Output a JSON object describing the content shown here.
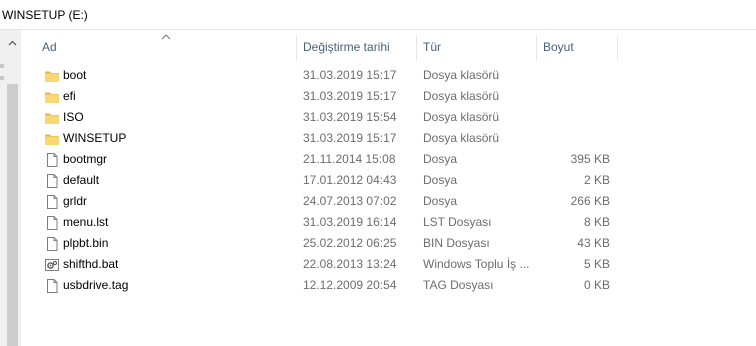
{
  "address_bar": {
    "path": "WINSETUP (E:)"
  },
  "columns": {
    "name": "Ad",
    "date": "Değiştirme tarihi",
    "type": "Tür",
    "size": "Boyut"
  },
  "files": [
    {
      "name": "boot",
      "date": "31.03.2019 15:17",
      "type": "Dosya klasörü",
      "size": "",
      "icon": "folder-icon"
    },
    {
      "name": "efi",
      "date": "31.03.2019 15:17",
      "type": "Dosya klasörü",
      "size": "",
      "icon": "folder-icon"
    },
    {
      "name": "ISO",
      "date": "31.03.2019 15:54",
      "type": "Dosya klasörü",
      "size": "",
      "icon": "folder-icon"
    },
    {
      "name": "WINSETUP",
      "date": "31.03.2019 15:17",
      "type": "Dosya klasörü",
      "size": "",
      "icon": "folder-icon"
    },
    {
      "name": "bootmgr",
      "date": "21.11.2014 15:08",
      "type": "Dosya",
      "size": "395 KB",
      "icon": "file-icon"
    },
    {
      "name": "default",
      "date": "17.01.2012 04:43",
      "type": "Dosya",
      "size": "2 KB",
      "icon": "file-icon"
    },
    {
      "name": "grldr",
      "date": "24.07.2013 07:02",
      "type": "Dosya",
      "size": "266 KB",
      "icon": "file-icon"
    },
    {
      "name": "menu.lst",
      "date": "31.03.2019 16:14",
      "type": "LST Dosyası",
      "size": "8 KB",
      "icon": "text-file-icon"
    },
    {
      "name": "plpbt.bin",
      "date": "25.02.2012 06:25",
      "type": "BIN Dosyası",
      "size": "43 KB",
      "icon": "file-icon"
    },
    {
      "name": "shifthd.bat",
      "date": "22.08.2013 13:24",
      "type": "Windows Toplu İş ...",
      "size": "5 KB",
      "icon": "batch-file-icon"
    },
    {
      "name": "usbdrive.tag",
      "date": "12.12.2009 20:54",
      "type": "TAG Dosyası",
      "size": "0 KB",
      "icon": "file-icon"
    }
  ],
  "colors": {
    "folder": "#f8d775",
    "folder_dark": "#e6b64a",
    "header_text": "#4c607a",
    "secondary_text": "#6d6d6d"
  }
}
